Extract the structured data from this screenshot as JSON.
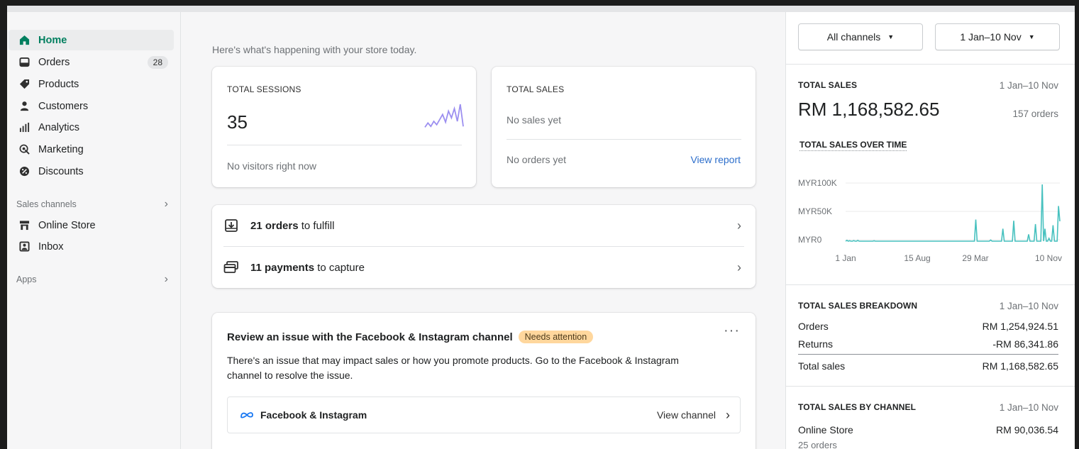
{
  "sidebar": {
    "items": [
      {
        "label": "Home",
        "icon": "home-icon",
        "active": true
      },
      {
        "label": "Orders",
        "icon": "orders-icon",
        "badge": "28"
      },
      {
        "label": "Products",
        "icon": "tag-icon"
      },
      {
        "label": "Customers",
        "icon": "person-icon"
      },
      {
        "label": "Analytics",
        "icon": "bar-chart-icon"
      },
      {
        "label": "Marketing",
        "icon": "target-icon"
      },
      {
        "label": "Discounts",
        "icon": "discount-icon"
      }
    ],
    "sales_channels_label": "Sales channels",
    "channels": [
      {
        "label": "Online Store",
        "icon": "store-icon"
      },
      {
        "label": "Inbox",
        "icon": "inbox-icon"
      }
    ],
    "apps_label": "Apps"
  },
  "main": {
    "greeting": "Here's what's happening with your store today.",
    "sessions_card": {
      "label": "TOTAL SESSIONS",
      "value": "35",
      "footer": "No visitors right now"
    },
    "sales_card": {
      "label": "TOTAL SALES",
      "no_sales": "No sales yet",
      "no_orders": "No orders yet",
      "link": "View report"
    },
    "tasks": [
      {
        "bold": "21 orders",
        "rest": " to fulfill",
        "icon": "download-box-icon"
      },
      {
        "bold": "11 payments",
        "rest": " to capture",
        "icon": "payment-icon"
      }
    ],
    "issue_card": {
      "title": "Review an issue with the Facebook & Instagram channel",
      "badge": "Needs attention",
      "body": "There's an issue that may impact sales or how you promote products. Go to the Facebook & Instagram channel to resolve the issue.",
      "channel_name": "Facebook & Instagram",
      "channel_link": "View channel"
    }
  },
  "right": {
    "channel_select": "All channels",
    "date_select": "1 Jan–10 Nov",
    "total_sales": {
      "label": "TOTAL SALES",
      "date": "1 Jan–10 Nov",
      "amount": "RM 1,168,582.65",
      "orders": "157 orders",
      "over_time_label": "TOTAL SALES OVER TIME"
    },
    "breakdown": {
      "label": "TOTAL SALES BREAKDOWN",
      "date": "1 Jan–10 Nov",
      "rows": [
        {
          "name": "Orders",
          "value": "RM 1,254,924.51"
        },
        {
          "name": "Returns",
          "value": "-RM 86,341.86"
        },
        {
          "name": "Total sales",
          "value": "RM 1,168,582.65"
        }
      ]
    },
    "by_channel": {
      "label": "TOTAL SALES BY CHANNEL",
      "date": "1 Jan–10 Nov",
      "channel": "Online Store",
      "value": "RM 90,036.54",
      "orders": "25 orders"
    }
  },
  "chart_data": [
    {
      "type": "line",
      "title": "TOTAL SALES OVER TIME",
      "y_ticks": [
        "MYR0",
        "MYR50K",
        "MYR100K"
      ],
      "x_ticks": [
        "1 Jan",
        "15 Aug",
        "29 Mar",
        "10 Nov"
      ],
      "ylim": [
        0,
        100000
      ],
      "color": "#47c1bf",
      "series": [
        {
          "values": [
            0,
            1500,
            0,
            800,
            0,
            0,
            1000,
            0,
            0,
            1200,
            0,
            0,
            0,
            0,
            0,
            0,
            0,
            0,
            0,
            0,
            0,
            600,
            0,
            0,
            0,
            0,
            0,
            0,
            0,
            0,
            0,
            0,
            0,
            0,
            0,
            0,
            0,
            0,
            0,
            0,
            0,
            0,
            0,
            0,
            0,
            0,
            0,
            0,
            0,
            0,
            0,
            0,
            0,
            0,
            0,
            0,
            0,
            0,
            0,
            0,
            0,
            0,
            0,
            0,
            0,
            0,
            0,
            0,
            0,
            0,
            0,
            0,
            0,
            0,
            0,
            0,
            0,
            0,
            0,
            0,
            0,
            0,
            0,
            0,
            0,
            0,
            0,
            0,
            0,
            0,
            0,
            0,
            0,
            0,
            0,
            0,
            38000,
            0,
            0,
            0,
            0,
            0,
            0,
            0,
            0,
            0,
            0,
            2000,
            0,
            0,
            0,
            0,
            0,
            0,
            0,
            0,
            22000,
            0,
            0,
            0,
            0,
            0,
            0,
            0,
            36000,
            0,
            0,
            0,
            0,
            0,
            0,
            0,
            0,
            0,
            0,
            12000,
            0,
            0,
            0,
            0,
            30000,
            0,
            0,
            0,
            0,
            100000,
            0,
            22000,
            0,
            0,
            5000,
            0,
            0,
            28000,
            0,
            0,
            0,
            62000,
            35000
          ]
        }
      ]
    },
    {
      "type": "line",
      "title": "",
      "series": [
        {
          "values": [
            3,
            8,
            4,
            10,
            6,
            12,
            18,
            9,
            22,
            14,
            25,
            10,
            30,
            4
          ]
        }
      ]
    }
  ]
}
